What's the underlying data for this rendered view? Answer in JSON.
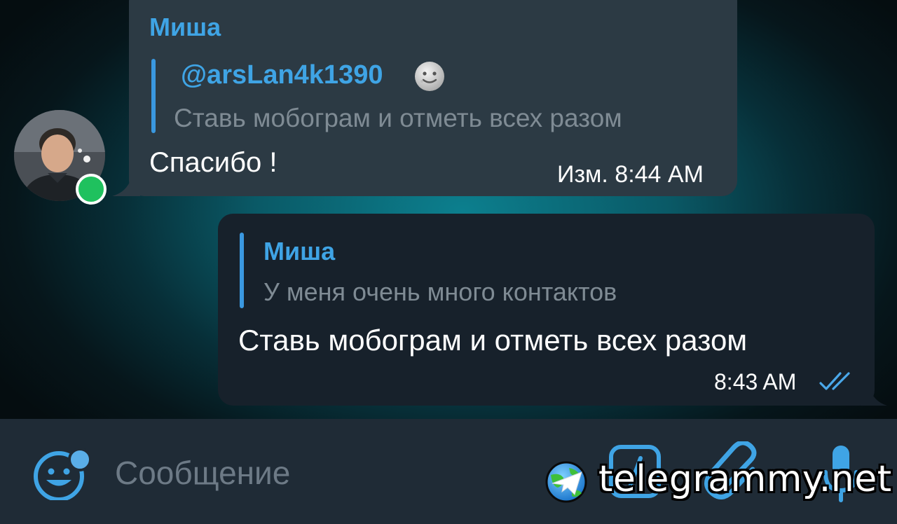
{
  "colors": {
    "accent": "#3fa4e5",
    "incoming_bubble": "#2c3a44",
    "outgoing_bubble": "#17212b",
    "input_bar": "#1f2b36",
    "online": "#1fc15e"
  },
  "messages": [
    {
      "direction": "incoming",
      "sender": "Миша",
      "reply_to": {
        "author": "@arsLan4k1390",
        "text": "Ставь мобограм и отметь всех разом"
      },
      "text": "Спасибо !",
      "time": "Изм. 8:44 AM",
      "avatar_icon": "user-avatar",
      "online": true
    },
    {
      "direction": "outgoing",
      "reply_to": {
        "author": "Миша",
        "text": "У меня очень много контактов"
      },
      "text": "Ставь мобограм и отметь всех разом",
      "time": "8:43 AM",
      "status_icon": "double-check-icon"
    }
  ],
  "composer": {
    "placeholder": "Сообщение",
    "icons": [
      "emoji-icon",
      "bot-command-icon",
      "attach-icon",
      "microphone-icon"
    ]
  },
  "watermark": {
    "text": "telegrammy.net"
  }
}
